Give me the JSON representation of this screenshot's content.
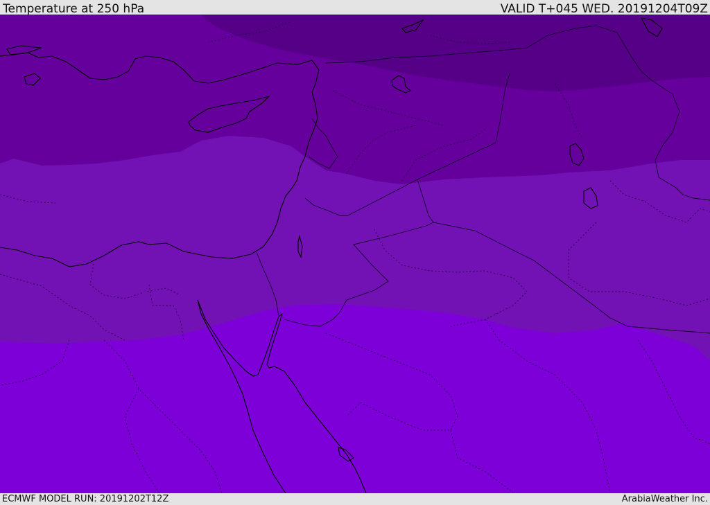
{
  "header": {
    "title": "Temperature at 250 hPa",
    "valid": "VALID T+045 WED. 20191204T09Z"
  },
  "footer": {
    "model_run": "ECMWF MODEL RUN: 20191202T12Z",
    "credit": "ArabiaWeather Inc."
  },
  "colors": {
    "band_coldest": "#560087",
    "band_cold": "#65009c",
    "band_mid": "#7212b4",
    "band_warm": "#7d00d9",
    "coastline": "#000000",
    "borders": "#1a0030"
  }
}
